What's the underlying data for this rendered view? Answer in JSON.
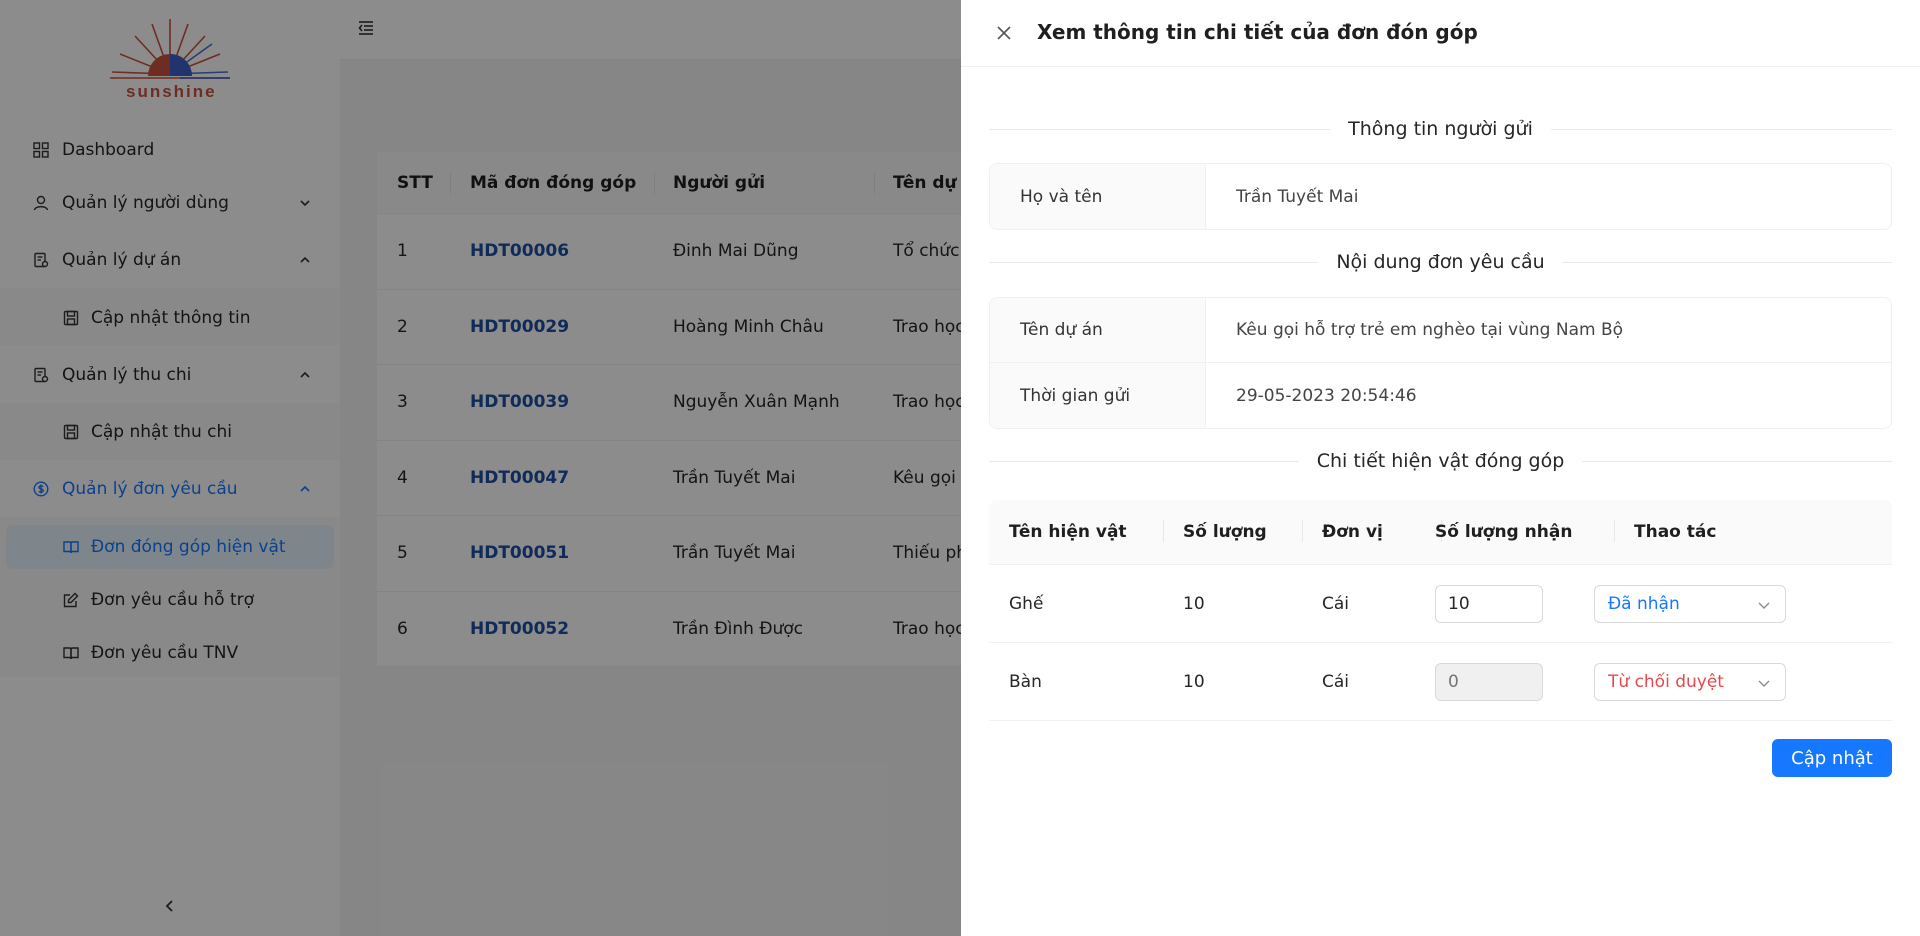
{
  "app": {
    "logo_text": "sunshine"
  },
  "sidebar": {
    "items": [
      {
        "label": "Dashboard",
        "icon": "dashboard-icon"
      },
      {
        "label": "Quản lý người dùng",
        "icon": "user-icon"
      },
      {
        "label": "Quản lý dự án",
        "icon": "project-icon"
      },
      {
        "label": "Cập nhật thông tin",
        "icon": "save-icon"
      },
      {
        "label": "Quản lý thu chi",
        "icon": "finance-icon"
      },
      {
        "label": "Cập nhật thu chi",
        "icon": "save-icon"
      },
      {
        "label": "Quản lý đơn yêu cầu",
        "icon": "dollar-circle-icon"
      },
      {
        "label": "Đơn đóng góp hiện vật",
        "icon": "book-icon"
      },
      {
        "label": "Đơn yêu cầu hỗ trợ",
        "icon": "edit-icon"
      },
      {
        "label": "Đơn yêu cầu TNV",
        "icon": "book-icon"
      }
    ]
  },
  "table": {
    "headers": [
      "STT",
      "Mã đơn đóng góp",
      "Người gửi",
      "Tên dự án"
    ],
    "rows": [
      {
        "stt": "1",
        "code": "HDT00006",
        "sender": "Đinh Mai Dũng",
        "project": "Tổ chức"
      },
      {
        "stt": "2",
        "code": "HDT00029",
        "sender": "Hoàng Minh Châu",
        "project": "Trao học"
      },
      {
        "stt": "3",
        "code": "HDT00039",
        "sender": "Nguyễn Xuân Mạnh",
        "project": "Trao học"
      },
      {
        "stt": "4",
        "code": "HDT00047",
        "sender": "Trần Tuyết Mai",
        "project": "Kêu gọi"
      },
      {
        "stt": "5",
        "code": "HDT00051",
        "sender": "Trần Tuyết Mai",
        "project": "Thiếu ph"
      },
      {
        "stt": "6",
        "code": "HDT00052",
        "sender": "Trần Đình Được",
        "project": "Trao học"
      }
    ]
  },
  "drawer": {
    "title": "Xem thông tin chi tiết của đơn đón góp",
    "section_sender": "Thông tin người gửi",
    "sender_rows": [
      {
        "label": "Họ và tên",
        "value": "Trần Tuyết Mai"
      }
    ],
    "section_request": "Nội dung đơn yêu cầu",
    "request_rows": [
      {
        "label": "Tên dự án",
        "value": "Kêu gọi hỗ trợ trẻ em nghèo tại vùng Nam Bộ"
      },
      {
        "label": "Thời gian gửi",
        "value": "29-05-2023 20:54:46"
      }
    ],
    "section_items": "Chi tiết hiện vật đóng góp",
    "items_headers": [
      "Tên hiện vật",
      "Số lượng",
      "Đơn vị",
      "Số lượng nhận",
      "Thao tác"
    ],
    "items": [
      {
        "name": "Ghế",
        "qty": "10",
        "unit": "Cái",
        "received": "10",
        "received_disabled": false,
        "action": "Đã nhận",
        "action_color": "#1677ff"
      },
      {
        "name": "Bàn",
        "qty": "10",
        "unit": "Cái",
        "received": "",
        "received_placeholder": "0",
        "received_disabled": true,
        "action": "Từ chối duyệt",
        "action_color": "#e5484d"
      }
    ],
    "update_label": "Cập nhật"
  },
  "colors": {
    "primary": "#1677ff",
    "code_link": "#1d4fa3",
    "danger": "#e5484d",
    "active_bg": "#e6f4ff",
    "logo_red": "#c9533d"
  }
}
